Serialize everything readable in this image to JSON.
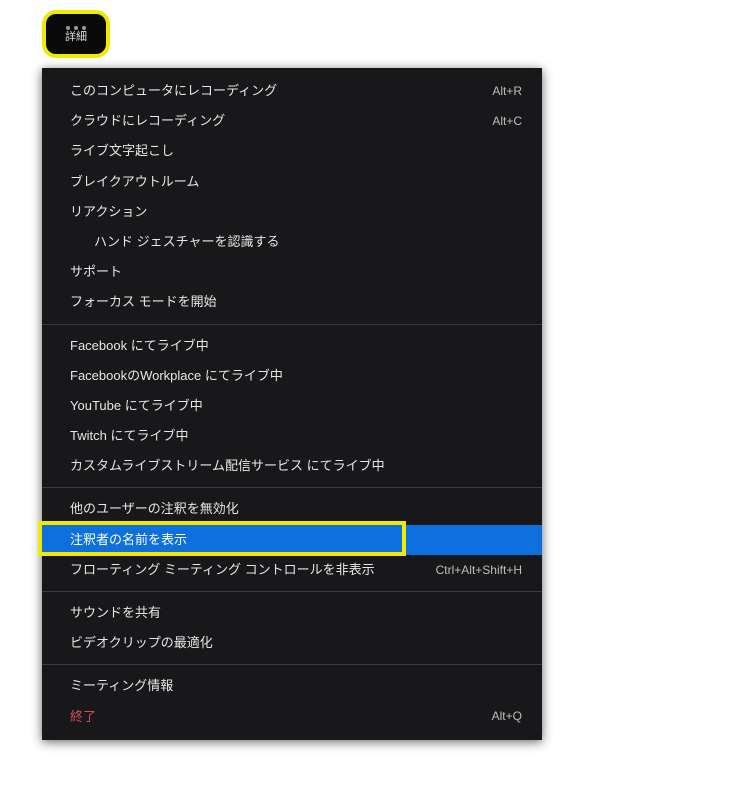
{
  "toolbar": {
    "label": "詳細"
  },
  "menu": {
    "groups": [
      [
        {
          "label": "このコンピュータにレコーディング",
          "shortcut": "Alt+R"
        },
        {
          "label": "クラウドにレコーディング",
          "shortcut": "Alt+C"
        },
        {
          "label": "ライブ文字起こし"
        },
        {
          "label": "ブレイクアウトルーム"
        },
        {
          "label": "リアクション"
        },
        {
          "label": "ハンド ジェスチャーを認識する",
          "indent": true
        },
        {
          "label": "サポート"
        },
        {
          "label": "フォーカス モードを開始"
        }
      ],
      [
        {
          "label": "Facebook にてライブ中"
        },
        {
          "label": "FacebookのWorkplace にてライブ中"
        },
        {
          "label": "YouTube にてライブ中"
        },
        {
          "label": "Twitch にてライブ中"
        },
        {
          "label": "カスタムライブストリーム配信サービス にてライブ中"
        }
      ],
      [
        {
          "label": "他のユーザーの注釈を無効化"
        },
        {
          "label": "注釈者の名前を表示",
          "highlighted": true,
          "boxed": true
        },
        {
          "label": "フローティング ミーティング コントロールを非表示",
          "shortcut": "Ctrl+Alt+Shift+H"
        }
      ],
      [
        {
          "label": "サウンドを共有"
        },
        {
          "label": "ビデオクリップの最適化"
        }
      ],
      [
        {
          "label": "ミーティング情報"
        },
        {
          "label": "終了",
          "shortcut": "Alt+Q",
          "danger": true
        }
      ]
    ]
  }
}
